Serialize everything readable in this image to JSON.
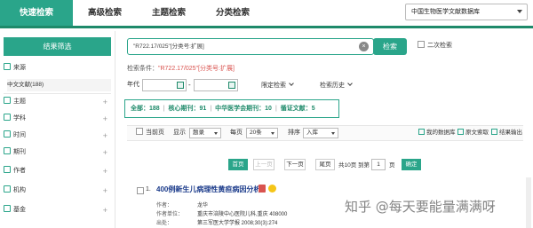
{
  "nav": {
    "tabs": [
      {
        "label": "快速检索",
        "active": true
      },
      {
        "label": "高级检索",
        "active": false
      },
      {
        "label": "主题检索",
        "active": false
      },
      {
        "label": "分类检索",
        "active": false
      }
    ],
    "database": "中国生物医学文献数据库"
  },
  "sidebar": {
    "title": "结果筛选",
    "source_label": "来源",
    "source_sub": "中文文献(188)",
    "facets": [
      "主题",
      "学科",
      "时间",
      "期刊",
      "作者",
      "机构",
      "基金"
    ]
  },
  "search": {
    "query": "\"R722.17/025\"[分类号:扩展]",
    "button": "检索",
    "secondary": "二次检索"
  },
  "conditions": {
    "label": "检索条件：",
    "value": "\"R722.17/025\"[分类号:扩展]"
  },
  "filters": {
    "year_label": "年代",
    "year_from": "",
    "year_to": "",
    "limit_label": "限定检索",
    "history_label": "检索历史"
  },
  "stats": {
    "all": "全部：188",
    "core": "核心期刊：91",
    "cma": "中华医学会期刊：10",
    "cited": "循证文献：5"
  },
  "toolbar": {
    "current_page": "当前页",
    "display_label": "显示",
    "display_value": "题录",
    "per_page_label": "每页",
    "per_page_value": "20条",
    "sort_label": "排序",
    "sort_value": "入库",
    "my_db": "我的数据库",
    "fulltext": "原文索取",
    "export": "结果输出"
  },
  "pager": {
    "first": "首页",
    "prev": "上一页",
    "next": "下一页",
    "last": "尾页",
    "total": "共10页 到第",
    "page_value": "1",
    "page_unit": "页",
    "go": "确定"
  },
  "result": {
    "number": "1.",
    "title": "400例新生儿病理性黄疸病因分析",
    "author_label": "作者：",
    "author": "龙华",
    "unit_label": "作者单位：",
    "unit": "重庆市涪陵中心医院儿科,重庆 408000",
    "source_label": "出处：",
    "source": "第三军医大学学报 2008;30(3):274"
  },
  "watermark": "知乎 @每天要能量满满呀",
  "colors": {
    "accent": "#2aa58a",
    "accent_dark": "#1e8a6a",
    "link": "#1a3a8a",
    "red": "#d9534f"
  }
}
